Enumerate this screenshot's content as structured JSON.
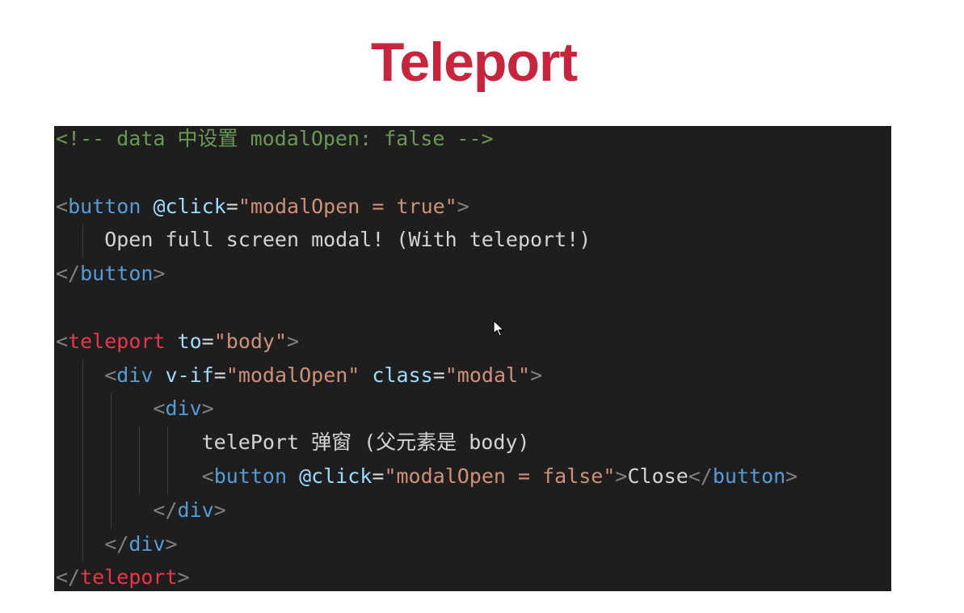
{
  "slide": {
    "title": "Teleport",
    "title_color": "#c7253e"
  },
  "editor": {
    "background": "#1e1e1e",
    "lines": [
      [
        {
          "t": "<!-- data 中设置 modalOpen: false -->",
          "c": "comment"
        }
      ],
      [],
      [
        {
          "t": "<",
          "c": "punct"
        },
        {
          "t": "button",
          "c": "tag"
        },
        {
          "t": " ",
          "c": "txt"
        },
        {
          "t": "@click",
          "c": "attr"
        },
        {
          "t": "=",
          "c": "txt"
        },
        {
          "t": "\"modalOpen = true\"",
          "c": "str"
        },
        {
          "t": ">",
          "c": "punct"
        }
      ],
      [
        {
          "t": "    Open full screen modal! (With teleport!)",
          "c": "txt"
        }
      ],
      [
        {
          "t": "</",
          "c": "punct"
        },
        {
          "t": "button",
          "c": "tag"
        },
        {
          "t": ">",
          "c": "punct"
        }
      ],
      [],
      [
        {
          "t": "<",
          "c": "punct"
        },
        {
          "t": "teleport",
          "c": "tag-red"
        },
        {
          "t": " ",
          "c": "txt"
        },
        {
          "t": "to",
          "c": "attr"
        },
        {
          "t": "=",
          "c": "txt"
        },
        {
          "t": "\"body\"",
          "c": "str"
        },
        {
          "t": ">",
          "c": "punct"
        }
      ],
      [
        {
          "t": "    ",
          "c": "txt"
        },
        {
          "t": "<",
          "c": "punct"
        },
        {
          "t": "div",
          "c": "tag"
        },
        {
          "t": " ",
          "c": "txt"
        },
        {
          "t": "v-if",
          "c": "attr"
        },
        {
          "t": "=",
          "c": "txt"
        },
        {
          "t": "\"modalOpen\"",
          "c": "str"
        },
        {
          "t": " ",
          "c": "txt"
        },
        {
          "t": "class",
          "c": "attr"
        },
        {
          "t": "=",
          "c": "txt"
        },
        {
          "t": "\"modal\"",
          "c": "str"
        },
        {
          "t": ">",
          "c": "punct"
        }
      ],
      [
        {
          "t": "        ",
          "c": "txt"
        },
        {
          "t": "<",
          "c": "punct"
        },
        {
          "t": "div",
          "c": "tag"
        },
        {
          "t": ">",
          "c": "punct"
        }
      ],
      [
        {
          "t": "            telePort 弹窗 (父元素是 body)",
          "c": "txt"
        }
      ],
      [
        {
          "t": "            ",
          "c": "txt"
        },
        {
          "t": "<",
          "c": "punct"
        },
        {
          "t": "button",
          "c": "tag"
        },
        {
          "t": " ",
          "c": "txt"
        },
        {
          "t": "@click",
          "c": "attr"
        },
        {
          "t": "=",
          "c": "txt"
        },
        {
          "t": "\"modalOpen = false\"",
          "c": "str"
        },
        {
          "t": ">",
          "c": "punct"
        },
        {
          "t": "Close",
          "c": "txt"
        },
        {
          "t": "</",
          "c": "punct"
        },
        {
          "t": "button",
          "c": "tag"
        },
        {
          "t": ">",
          "c": "punct"
        }
      ],
      [
        {
          "t": "        ",
          "c": "txt"
        },
        {
          "t": "</",
          "c": "punct"
        },
        {
          "t": "div",
          "c": "tag"
        },
        {
          "t": ">",
          "c": "punct"
        }
      ],
      [
        {
          "t": "    ",
          "c": "txt"
        },
        {
          "t": "</",
          "c": "punct"
        },
        {
          "t": "div",
          "c": "tag"
        },
        {
          "t": ">",
          "c": "punct"
        }
      ],
      [
        {
          "t": "</",
          "c": "punct"
        },
        {
          "t": "teleport",
          "c": "tag-red"
        },
        {
          "t": ">",
          "c": "punct"
        }
      ]
    ]
  },
  "cursor": {
    "icon": "mouse-pointer-icon"
  }
}
